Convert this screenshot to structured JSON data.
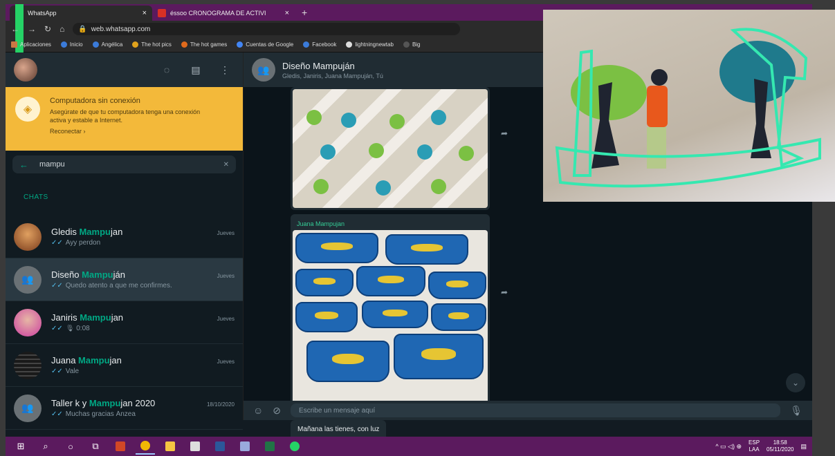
{
  "browser": {
    "tabs": [
      {
        "title": "WhatsApp",
        "icon": "whatsapp-icon"
      },
      {
        "title": "éssoo CRONOGRAMA DE ACTIVI",
        "icon": "gmail-icon"
      }
    ],
    "url": "web.whatsapp.com",
    "bookmarks": [
      "Aplicaciones",
      "Inicio",
      "Angélica",
      "The hot pics",
      "The hot games",
      "Cuentas de Google",
      "Facebook",
      "lightningnewtab",
      "Big"
    ]
  },
  "banner": {
    "title": "Computadora sin conexión",
    "text": "Asegúrate de que tu computadora tenga una conexión activa y estable a Internet.",
    "reconnect": "Reconectar ›"
  },
  "search": {
    "value": "mampu"
  },
  "section_label": "CHATS",
  "chats": [
    {
      "pre": "Gledis ",
      "match": "Mampu",
      "post": "jan",
      "time": "Jueves",
      "preview": "Ayy perdon",
      "avatar": "photo"
    },
    {
      "pre": "Diseño ",
      "match": "Mampu",
      "post": "ján",
      "time": "Jueves",
      "preview": "Quedo atento a que me confirmes.",
      "avatar": "group"
    },
    {
      "pre": "Janiris ",
      "match": "Mampu",
      "post": "jan",
      "time": "Jueves",
      "preview": "0:08",
      "avatar": "photo"
    },
    {
      "pre": "Juana ",
      "match": "Mampu",
      "post": "jan",
      "time": "Jueves",
      "preview": "Vale",
      "avatar": "photo"
    },
    {
      "pre": "Taller k y ",
      "match": "Mampu",
      "post": "jan 2020",
      "time": "18/10/2020",
      "preview": "Muchas gracias Ánzea",
      "avatar": "group"
    }
  ],
  "conversation": {
    "title": "Diseño Mampuján",
    "subtitle": "Gledis, Janiris, Juana Mampuján, Tú",
    "sender": "Juana Mampujan",
    "caption": "Mañana las tienes, con luz",
    "composer_placeholder": "Escribe un mensaje aquí"
  },
  "taskbar": {
    "lang": "ESP",
    "lang_sub": "LAA",
    "time": "18:58",
    "date": "05/11/2020"
  },
  "colors": {
    "accent": "#00a884",
    "banner": "#f3b93a",
    "chrome": "#5b1a5e",
    "highlight": "#35e8b0"
  }
}
